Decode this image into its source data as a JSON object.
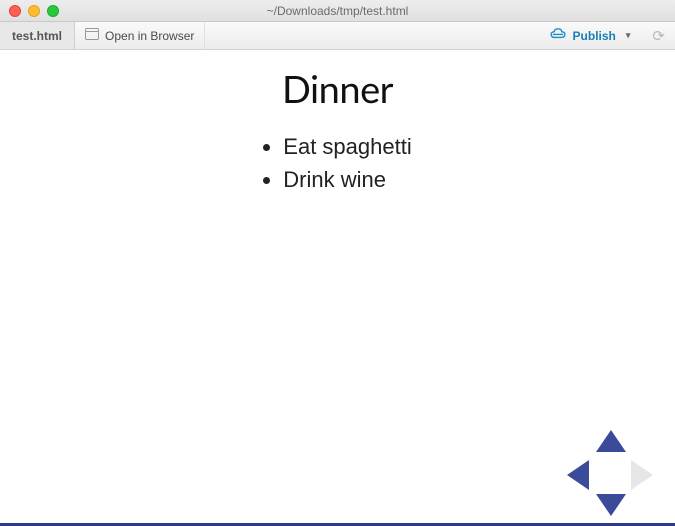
{
  "window": {
    "title": "~/Downloads/tmp/test.html"
  },
  "toolbar": {
    "tab_label": "test.html",
    "open_label": "Open in Browser",
    "publish_label": "Publish"
  },
  "slide": {
    "title": "Dinner",
    "items": [
      "Eat spaghetti",
      "Drink wine"
    ]
  }
}
